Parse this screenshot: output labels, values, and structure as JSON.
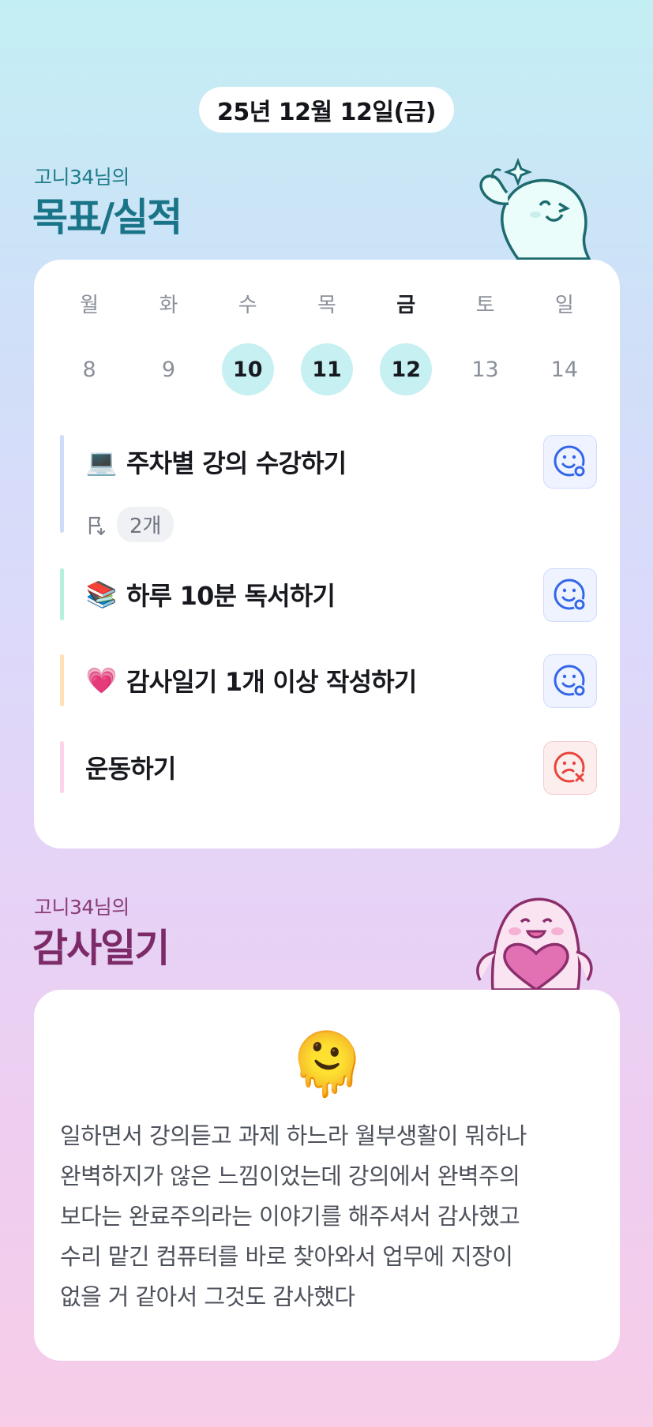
{
  "date": "25년 12월 12일(금)",
  "goals_section": {
    "subtitle": "고니34님의",
    "title": "목표/실적"
  },
  "week": {
    "days": [
      {
        "name": "월",
        "num": "8",
        "done": false,
        "today": false
      },
      {
        "name": "화",
        "num": "9",
        "done": false,
        "today": false
      },
      {
        "name": "수",
        "num": "10",
        "done": true,
        "today": false
      },
      {
        "name": "목",
        "num": "11",
        "done": true,
        "today": false
      },
      {
        "name": "금",
        "num": "12",
        "done": true,
        "today": true
      },
      {
        "name": "토",
        "num": "13",
        "done": false,
        "today": false
      },
      {
        "name": "일",
        "num": "14",
        "done": false,
        "today": false
      }
    ]
  },
  "goals": [
    {
      "emoji": "💻",
      "label": "주차별 강의 수강하기",
      "bar_color": "#cfdcf8",
      "status": "success",
      "subgoal_count": "2개"
    },
    {
      "emoji": "📚",
      "label": "하루 10분 독서하기",
      "bar_color": "#b4f0dc",
      "status": "success"
    },
    {
      "emoji": "💗",
      "label": "감사일기 1개 이상 작성하기",
      "bar_color": "#fde0b8",
      "status": "success"
    },
    {
      "emoji": "",
      "label": "운동하기",
      "bar_color": "#fbd3ea",
      "status": "fail"
    }
  ],
  "diary_section": {
    "subtitle": "고니34님의",
    "title": "감사일기",
    "emoji": "🫠",
    "lines": [
      "일하면서 강의듣고 과제 하느라 월부생활이 뭐하나",
      "완벽하지가 않은 느낌이었는데 강의에서 완벽주의",
      "보다는 완료주의라는 이야기를 해주셔서 감사했고",
      "수리 맡긴 컴퓨터를 바로 찾아와서 업무에 지장이",
      "없을 거 같아서 그것도 감사했다"
    ]
  },
  "colors": {
    "done_day_bg": "#c6f0f2",
    "success_icon": "#3366e8",
    "fail_icon": "#e8453c"
  }
}
